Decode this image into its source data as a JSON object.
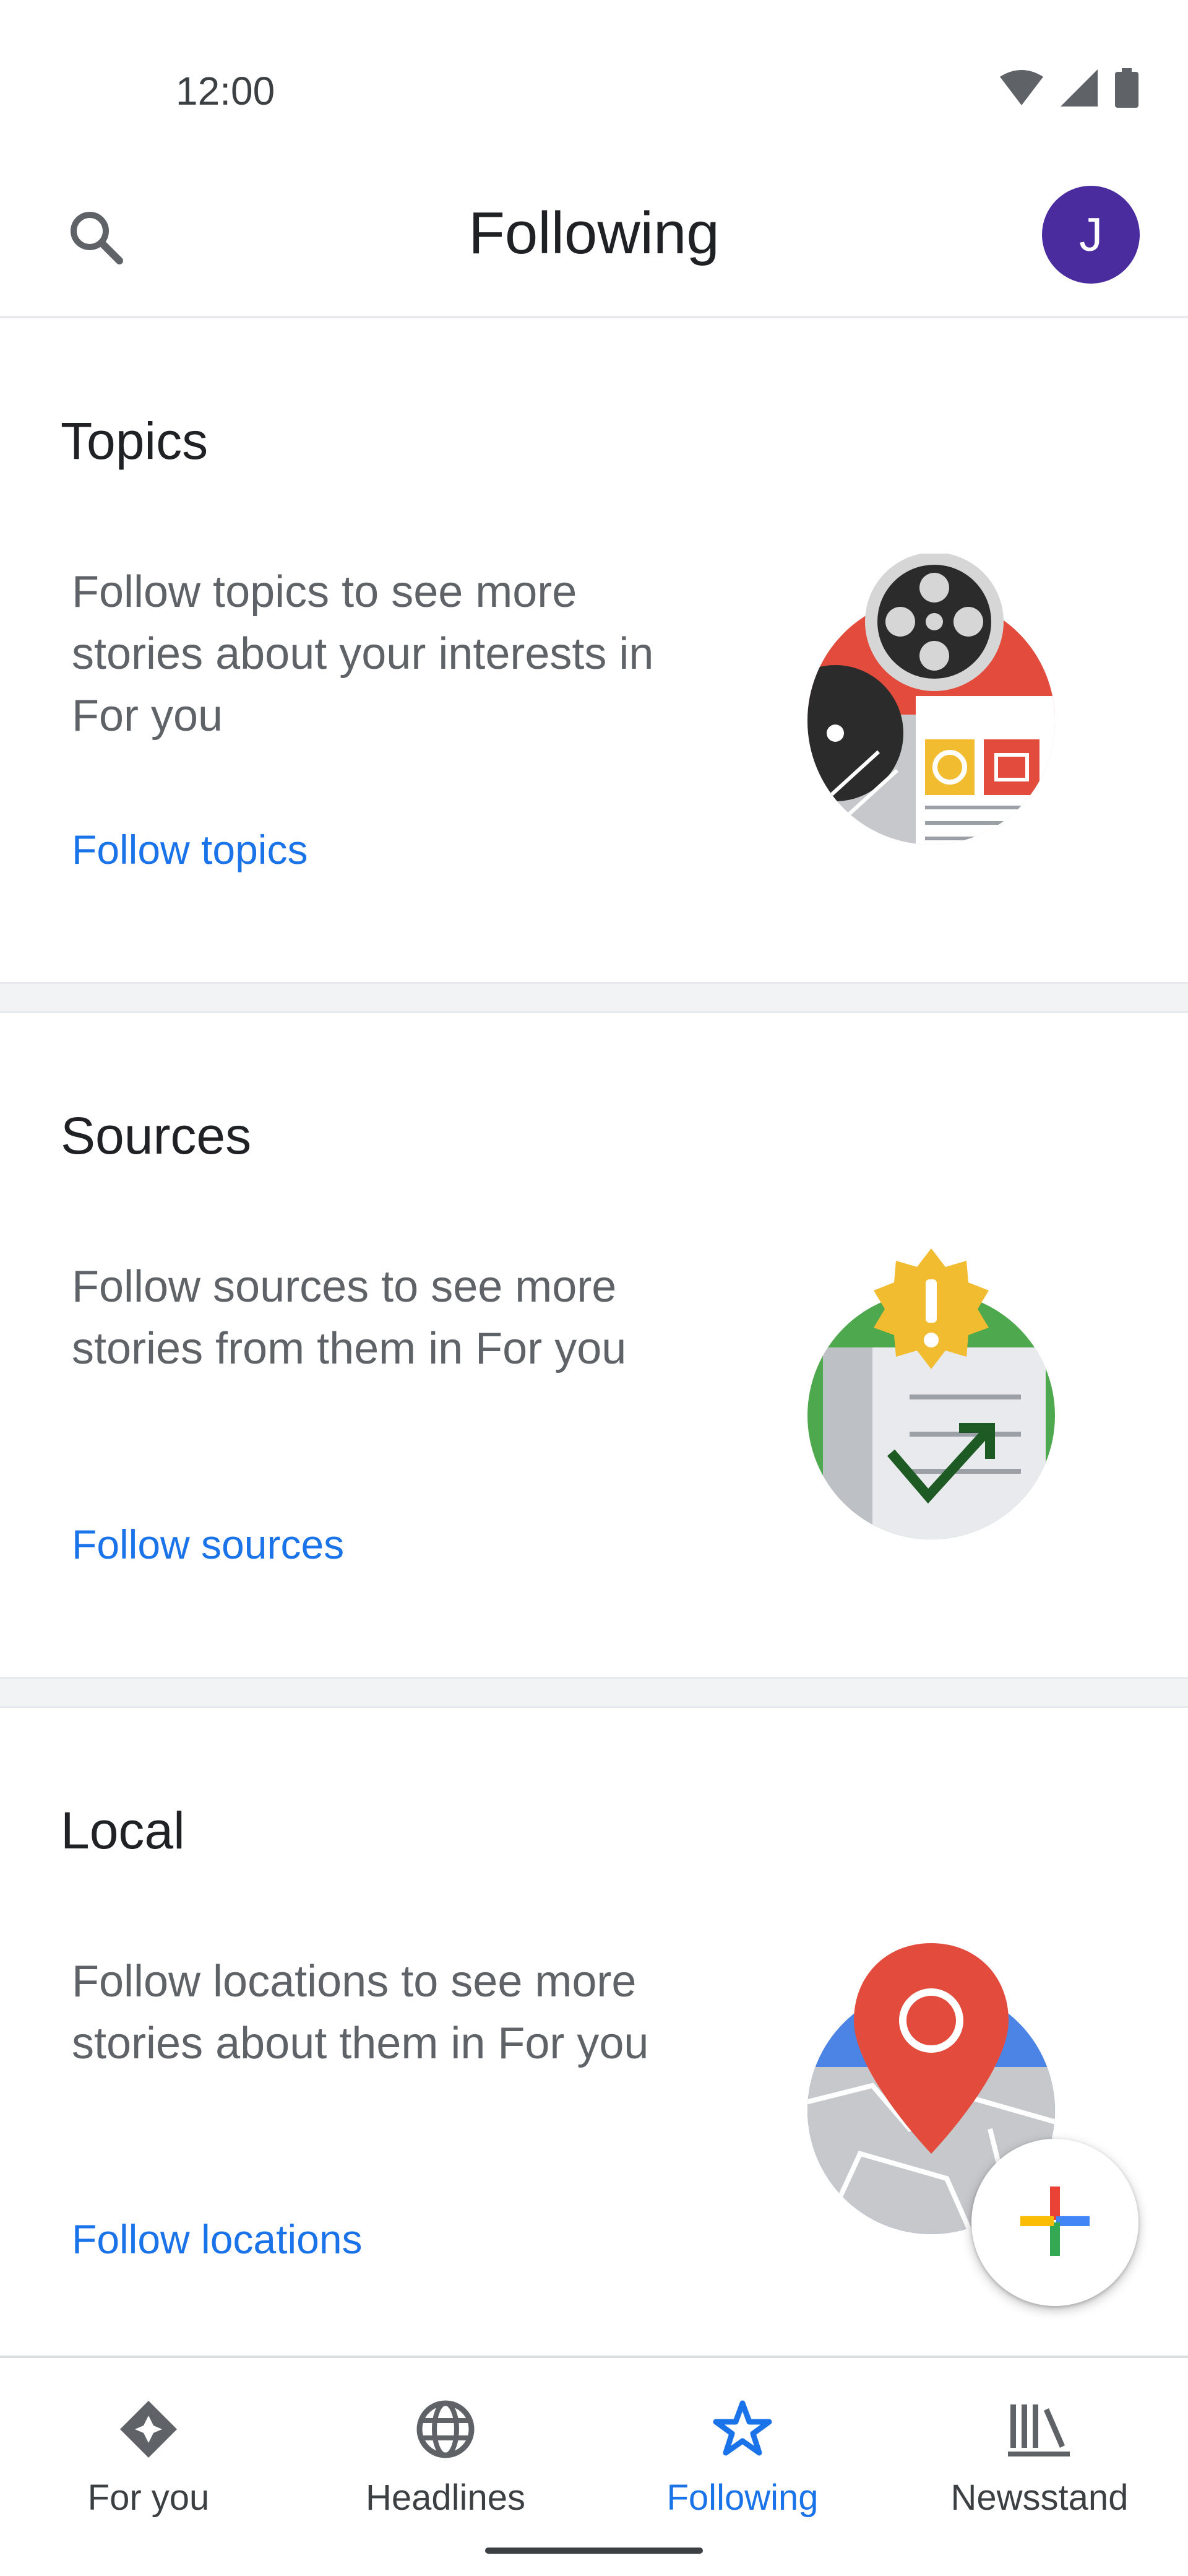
{
  "status_bar": {
    "time": "12:00",
    "icons": [
      "wifi-icon",
      "cell-signal-icon",
      "battery-icon"
    ]
  },
  "app_bar": {
    "title": "Following",
    "search_icon": "search-icon",
    "avatar_initial": "J",
    "avatar_color": "#4a2c9f"
  },
  "sections": [
    {
      "heading": "Topics",
      "description": "Follow topics to see more stories about your interests in For you",
      "link": "Follow topics",
      "illustration": "topics-illustration"
    },
    {
      "heading": "Sources",
      "description": "Follow sources to see more stories from them in For you",
      "link": "Follow sources",
      "illustration": "sources-illustration"
    },
    {
      "heading": "Local",
      "description": "Follow locations to see more stories about them in For you",
      "link": "Follow locations",
      "illustration": "local-illustration"
    }
  ],
  "fab": {
    "icon": "plus-icon"
  },
  "bottom_nav": [
    {
      "label": "For you",
      "icon": "sparkle-diamond-icon",
      "active": false
    },
    {
      "label": "Headlines",
      "icon": "globe-icon",
      "active": false
    },
    {
      "label": "Following",
      "icon": "star-icon",
      "active": true
    },
    {
      "label": "Newsstand",
      "icon": "newsstand-icon",
      "active": false
    }
  ],
  "colors": {
    "accent": "#1a73e8",
    "divider": "#f1f3f4",
    "text_primary": "#202124",
    "text_secondary": "#5f6368"
  }
}
